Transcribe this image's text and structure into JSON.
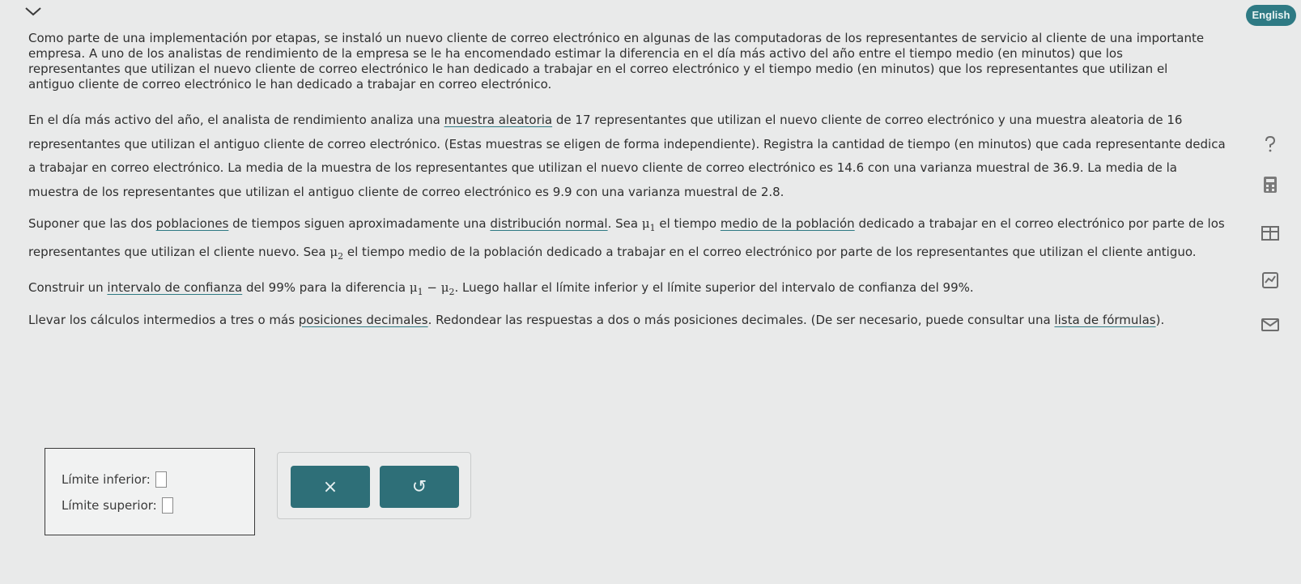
{
  "header": {
    "menu_icon": "chevron-down-icon",
    "language_label": "English"
  },
  "intro": {
    "text": "Como parte de una implementación por etapas, se instaló un nuevo cliente de correo electrónico en algunas de las computadoras de los representantes de servicio al cliente de una importante empresa. A uno de los analistas de rendimiento de la empresa se le ha encomendado estimar la diferencia en el día más activo del año entre el tiempo medio (en minutos) que los representantes que utilizan el nuevo cliente de correo electrónico le han dedicado a trabajar en el correo electrónico y el tiempo medio (en minutos) que los representantes que utilizan el antiguo cliente de correo electrónico le han dedicado a trabajar en correo electrónico."
  },
  "sample": {
    "pre": "En el día más activo del año, el analista de rendimiento analiza una ",
    "link": "muestra aleatoria",
    "post": " de 17 representantes que utilizan el nuevo cliente de correo electrónico y una muestra aleatoria de 16 representantes que utilizan el antiguo cliente de correo electrónico. (Estas muestras se eligen de forma independiente). Registra la cantidad de tiempo (en minutos) que cada representante dedica a trabajar en correo electrónico. La media de la muestra de los representantes que utilizan el nuevo cliente de correo electrónico es 14.6 con una varianza muestral de 36.9. La media de la muestra de los representantes que utilizan el antiguo cliente de correo electrónico es 9.9 con una varianza muestral de 2.8."
  },
  "assume": {
    "t1": "Suponer que las dos ",
    "link1": "poblaciones",
    "t2": " de tiempos siguen aproximadamente una ",
    "link2": "distribución normal",
    "t3": ". Sea ",
    "mu1": "μ",
    "mu1_sub": "1",
    "t4": " el tiempo ",
    "link3": "medio de la población",
    "t5": " dedicado a trabajar en el correo electrónico por parte de los representantes que utilizan el cliente nuevo. Sea ",
    "mu2": "μ",
    "mu2_sub": "2",
    "t6": " el tiempo medio de la población dedicado a trabajar en el correo electrónico por parte de los representantes que utilizan el cliente antiguo."
  },
  "construct": {
    "t1": "Construir un ",
    "link": "intervalo de confianza",
    "t2": " del 99% para la diferencia ",
    "mu_a": "μ",
    "sub_a": "1",
    "minus": " − ",
    "mu_b": "μ",
    "sub_b": "2",
    "t3": ". Luego hallar el límite inferior y el límite superior del intervalo de confianza del 99%."
  },
  "rounding": {
    "t1": "Llevar los cálculos intermedios a tres o más ",
    "link1": "posiciones decimales",
    "t2": ". Redondear las respuestas a dos o más posiciones decimales. (De ser necesario, puede consultar una ",
    "link2": "lista de fórmulas",
    "t3": ")."
  },
  "answer": {
    "lower_label": "Límite inferior:",
    "upper_label": "Límite superior:"
  },
  "buttons": {
    "clear_symbol": "×",
    "undo_symbol": "↺"
  },
  "side_tools": [
    "help-icon",
    "calculator-icon",
    "data-table-icon",
    "chart-icon",
    "mail-icon"
  ]
}
